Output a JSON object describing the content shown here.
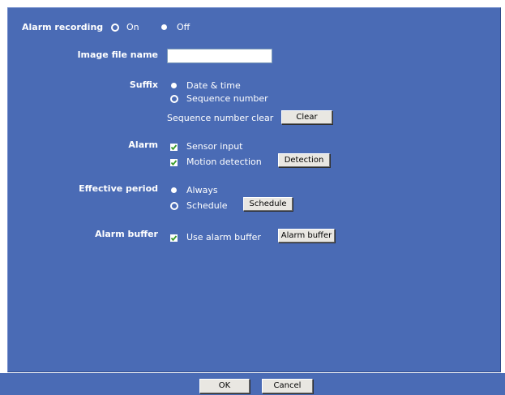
{
  "alarm_recording": {
    "label": "Alarm recording",
    "on": "On",
    "off": "Off",
    "selected": "On"
  },
  "image_file_name": {
    "label": "Image file name",
    "value": ""
  },
  "suffix": {
    "label": "Suffix",
    "options": [
      "Date & time",
      "Sequence number"
    ],
    "selected": "Sequence number",
    "clear_label": "Sequence number clear",
    "clear_button": "Clear"
  },
  "alarm": {
    "label": "Alarm",
    "sensor_input": "Sensor input",
    "motion_detection": "Motion detection",
    "detection_button": "Detection"
  },
  "effective_period": {
    "label": "Effective period",
    "always": "Always",
    "schedule": "Schedule",
    "selected": "Schedule",
    "schedule_button": "Schedule"
  },
  "alarm_buffer": {
    "label": "Alarm buffer",
    "use": "Use alarm buffer",
    "button": "Alarm buffer"
  },
  "footer": {
    "ok": "OK",
    "cancel": "Cancel"
  },
  "colors": {
    "panel": "#4a6bb5",
    "checkbox_mark": "#3a9a2a"
  }
}
